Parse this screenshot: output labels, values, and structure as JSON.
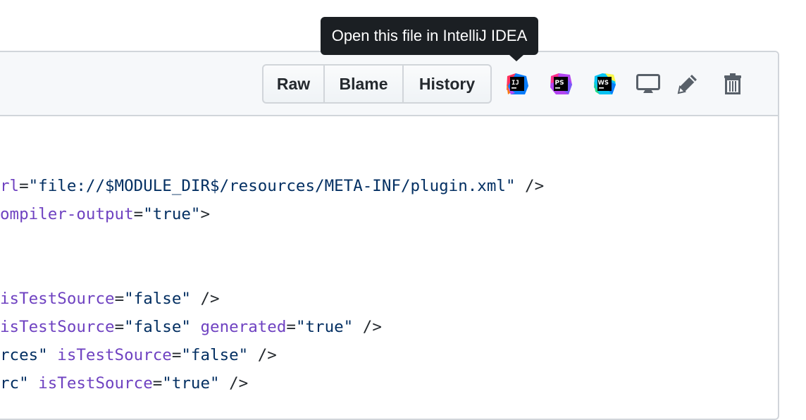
{
  "tooltip": {
    "text": "Open this file in IntelliJ IDEA"
  },
  "toolbar": {
    "raw_label": "Raw",
    "blame_label": "Blame",
    "history_label": "History",
    "icons": [
      {
        "name": "intellij-idea-icon",
        "label": "IJ"
      },
      {
        "name": "phpstorm-icon",
        "label": "PS"
      },
      {
        "name": "webstorm-icon",
        "label": "WS"
      },
      {
        "name": "desktop-icon"
      },
      {
        "name": "pencil-edit-icon"
      },
      {
        "name": "trash-delete-icon"
      }
    ]
  },
  "code": {
    "lines": [
      {
        "segments": [
          {
            "t": "rl",
            "c": "attr"
          },
          {
            "t": "=",
            "c": "plain"
          },
          {
            "t": "\"file://$MODULE_DIR$/resources/META-INF/plugin.xml\"",
            "c": "str"
          },
          {
            "t": " />",
            "c": "plain"
          }
        ]
      },
      {
        "segments": [
          {
            "t": "ompiler-output",
            "c": "attr"
          },
          {
            "t": "=",
            "c": "plain"
          },
          {
            "t": "\"true\"",
            "c": "str"
          },
          {
            "t": ">",
            "c": "plain"
          }
        ]
      },
      {
        "segments": []
      },
      {
        "segments": []
      },
      {
        "segments": [
          {
            "t": "isTestSource",
            "c": "attr"
          },
          {
            "t": "=",
            "c": "plain"
          },
          {
            "t": "\"false\"",
            "c": "str"
          },
          {
            "t": " />",
            "c": "plain"
          }
        ]
      },
      {
        "segments": [
          {
            "t": "isTestSource",
            "c": "attr"
          },
          {
            "t": "=",
            "c": "plain"
          },
          {
            "t": "\"false\"",
            "c": "str"
          },
          {
            "t": " ",
            "c": "plain"
          },
          {
            "t": "generated",
            "c": "attr"
          },
          {
            "t": "=",
            "c": "plain"
          },
          {
            "t": "\"true\"",
            "c": "str"
          },
          {
            "t": " />",
            "c": "plain"
          }
        ]
      },
      {
        "segments": [
          {
            "t": "rces\"",
            "c": "str"
          },
          {
            "t": " ",
            "c": "plain"
          },
          {
            "t": "isTestSource",
            "c": "attr"
          },
          {
            "t": "=",
            "c": "plain"
          },
          {
            "t": "\"false\"",
            "c": "str"
          },
          {
            "t": " />",
            "c": "plain"
          }
        ]
      },
      {
        "segments": [
          {
            "t": "rc\"",
            "c": "str"
          },
          {
            "t": " ",
            "c": "plain"
          },
          {
            "t": "isTestSource",
            "c": "attr"
          },
          {
            "t": "=",
            "c": "plain"
          },
          {
            "t": "\"true\"",
            "c": "str"
          },
          {
            "t": " />",
            "c": "plain"
          }
        ]
      }
    ]
  }
}
